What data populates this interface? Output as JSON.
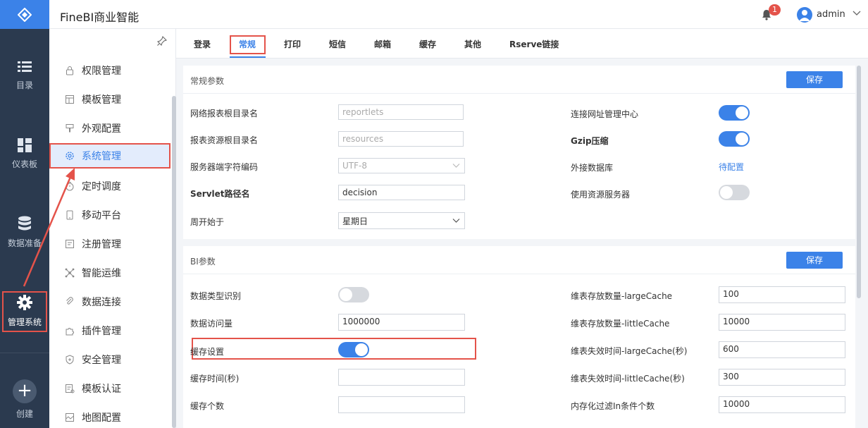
{
  "app": {
    "title": "FineBI商业智能"
  },
  "header": {
    "notification_count": "1",
    "username": "admin"
  },
  "rail": {
    "items": [
      {
        "label": "目录",
        "icon": "list-icon"
      },
      {
        "label": "仪表板",
        "icon": "dashboard-icon"
      },
      {
        "label": "数据准备",
        "icon": "database-icon"
      },
      {
        "label": "管理系统",
        "icon": "gear-icon"
      },
      {
        "label": "创建",
        "icon": "plus-icon"
      }
    ]
  },
  "sidebar": {
    "items": [
      {
        "label": "权限管理",
        "icon": "lock-icon"
      },
      {
        "label": "模板管理",
        "icon": "template-icon"
      },
      {
        "label": "外观配置",
        "icon": "brush-icon"
      },
      {
        "label": "系统管理",
        "icon": "settings-icon",
        "active": true
      },
      {
        "label": "定时调度",
        "icon": "timer-icon"
      },
      {
        "label": "移动平台",
        "icon": "mobile-icon"
      },
      {
        "label": "注册管理",
        "icon": "register-icon"
      },
      {
        "label": "智能运维",
        "icon": "network-icon"
      },
      {
        "label": "数据连接",
        "icon": "link-icon"
      },
      {
        "label": "插件管理",
        "icon": "plugin-icon"
      },
      {
        "label": "安全管理",
        "icon": "shield-icon"
      },
      {
        "label": "模板认证",
        "icon": "certificate-icon"
      },
      {
        "label": "地图配置",
        "icon": "map-icon"
      }
    ]
  },
  "tabs": [
    {
      "label": "登录"
    },
    {
      "label": "常规",
      "active": true
    },
    {
      "label": "打印"
    },
    {
      "label": "短信"
    },
    {
      "label": "邮箱"
    },
    {
      "label": "缓存"
    },
    {
      "label": "其他"
    },
    {
      "label": "Rserve链接"
    }
  ],
  "general": {
    "title": "常规参数",
    "save": "保存",
    "report_root_label": "网络报表根目录名",
    "report_root_value": "reportlets",
    "resource_root_label": "报表资源根目录名",
    "resource_root_value": "resources",
    "charset_label": "服务器端字符编码",
    "charset_value": "UTF-8",
    "servlet_label": "Servlet路径名",
    "servlet_value": "decision",
    "week_start_label": "周开始于",
    "week_start_value": "星期日",
    "url_center_label": "连接网址管理中心",
    "url_center_on": true,
    "gzip_label": "Gzip压缩",
    "gzip_on": true,
    "external_db_label": "外接数据库",
    "external_db_value": "待配置",
    "resource_server_label": "使用资源服务器",
    "resource_server_on": false
  },
  "bi": {
    "title": "BI参数",
    "save": "保存",
    "type_detect_label": "数据类型识别",
    "type_detect_on": false,
    "visits_label": "数据访问量",
    "visits_value": "1000000",
    "cache_setting_label": "缓存设置",
    "cache_setting_on": true,
    "cache_time_label": "缓存时间(秒)",
    "cache_time_value": "",
    "cache_count_label": "缓存个数",
    "cache_count_value": "",
    "large_cache_label": "维表存放数量-largeCache",
    "large_cache_value": "100",
    "little_cache_label": "维表存放数量-littleCache",
    "little_cache_value": "10000",
    "large_expire_label": "维表失效时间-largeCache(秒)",
    "large_expire_value": "600",
    "little_expire_label": "维表失效时间-littleCache(秒)",
    "little_expire_value": "300",
    "in_filter_label": "内存化过滤In条件个数",
    "in_filter_value": "10000"
  },
  "colors": {
    "accent": "#3b82e8",
    "rail_bg": "#2b3a4f",
    "highlight": "#e4534a"
  }
}
